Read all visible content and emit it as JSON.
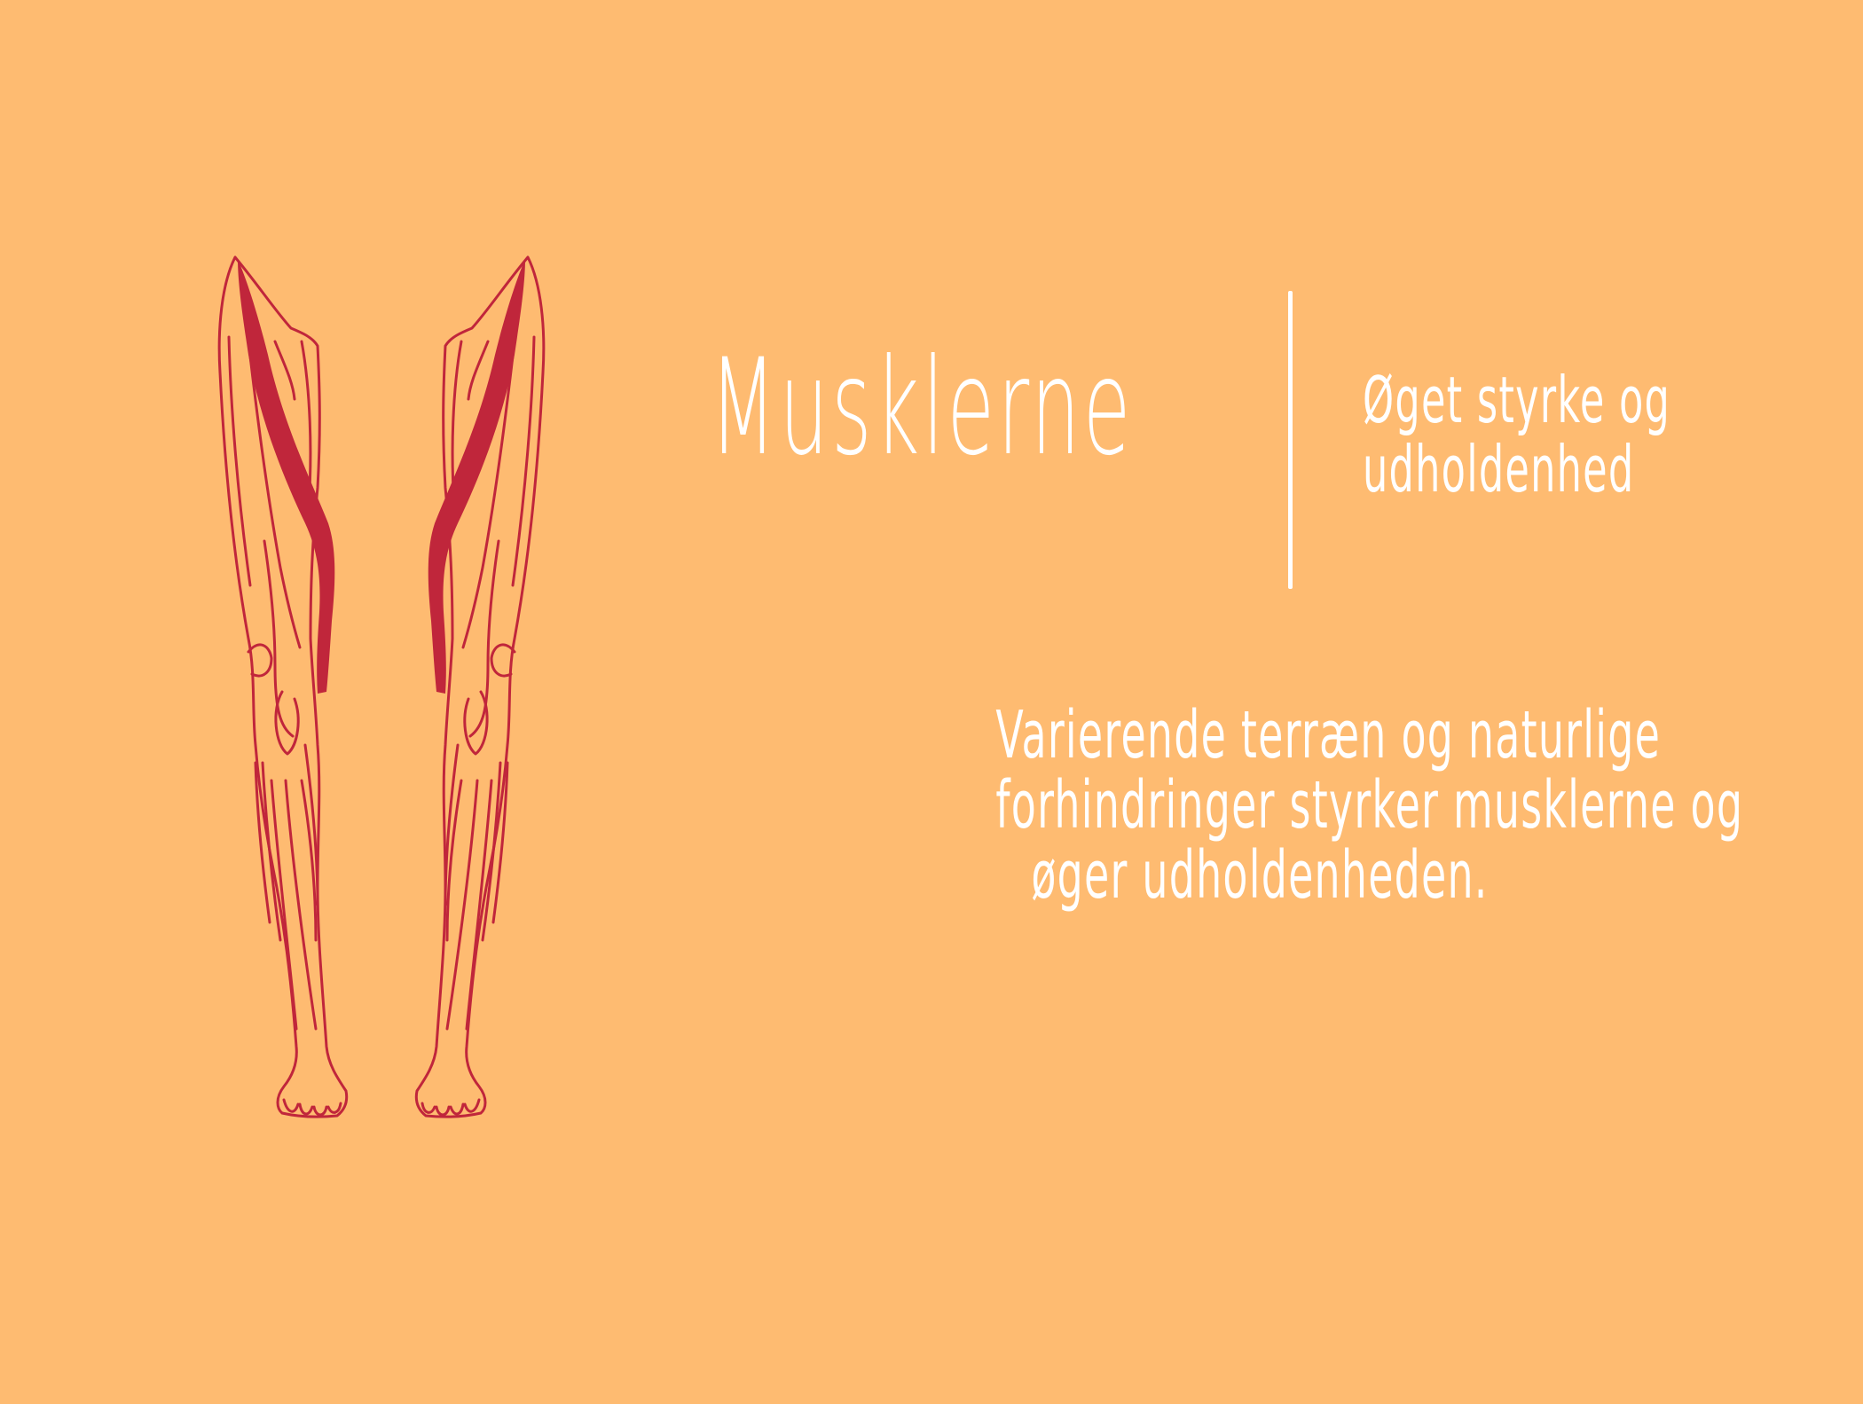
{
  "heading": {
    "title": "Musklerne",
    "subtitle_lines": [
      "Øget styrke og",
      "udholdenhed"
    ]
  },
  "description_lines": [
    "Varierende terræn og naturlige",
    "forhindringer styrker musklerne og",
    "øger udholdenheden."
  ],
  "colors": {
    "background": "#FEBB71",
    "outline": "#C0263B",
    "highlight_muscle": "#C0263B",
    "text": "#FFFFFF"
  },
  "illustration": {
    "icon": "legs-muscle-anatomy-icon",
    "highlighted": "sartorius"
  }
}
